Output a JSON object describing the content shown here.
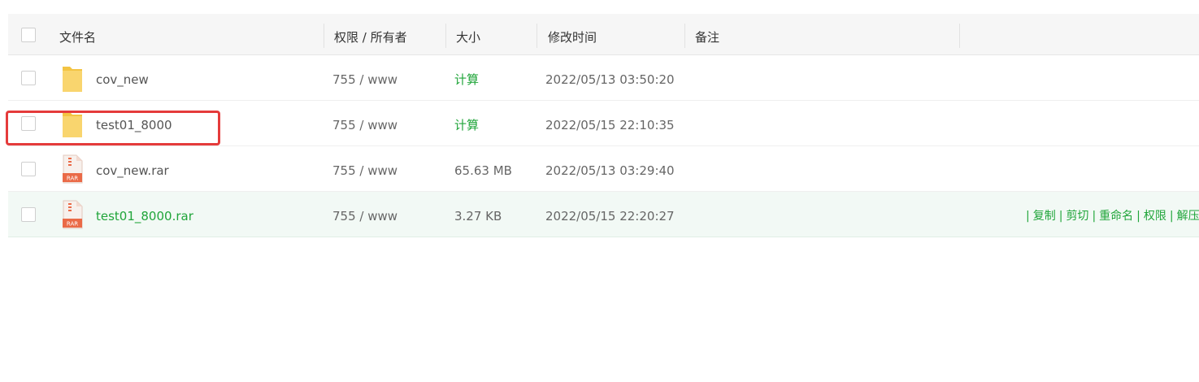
{
  "header": {
    "filename": "文件名",
    "permission": "权限 / 所有者",
    "size": "大小",
    "modified": "修改时间",
    "remark": "备注"
  },
  "rows": [
    {
      "name": "cov_new",
      "type": "folder",
      "permission": "755 / www",
      "size": "计算",
      "modified": "2022/05/13 03:50:20"
    },
    {
      "name": "test01_8000",
      "type": "folder",
      "permission": "755 / www",
      "size": "计算",
      "modified": "2022/05/15 22:10:35"
    },
    {
      "name": "cov_new.rar",
      "type": "rar",
      "permission": "755 / www",
      "size": "65.63 MB",
      "modified": "2022/05/13 03:29:40"
    },
    {
      "name": "test01_8000.rar",
      "type": "rar",
      "permission": "755 / www",
      "size": "3.27 KB",
      "modified": "2022/05/15 22:20:27"
    }
  ],
  "row_actions": {
    "separator": "|",
    "copy": "复制",
    "cut": "剪切",
    "rename": "重命名",
    "permission": "权限",
    "extract": "解压"
  },
  "icons": {
    "folder": "folder-icon",
    "archive": "rar-file-icon",
    "archive_badge": "RAR"
  },
  "colors": {
    "accent_green": "#20a53a",
    "folder_yellow": "#f9d56e",
    "rar_orange": "#ea6a47",
    "highlight_red": "#e53b3b",
    "selected_row_bg": "#f2f9f5",
    "header_bg": "#f6f6f6"
  }
}
